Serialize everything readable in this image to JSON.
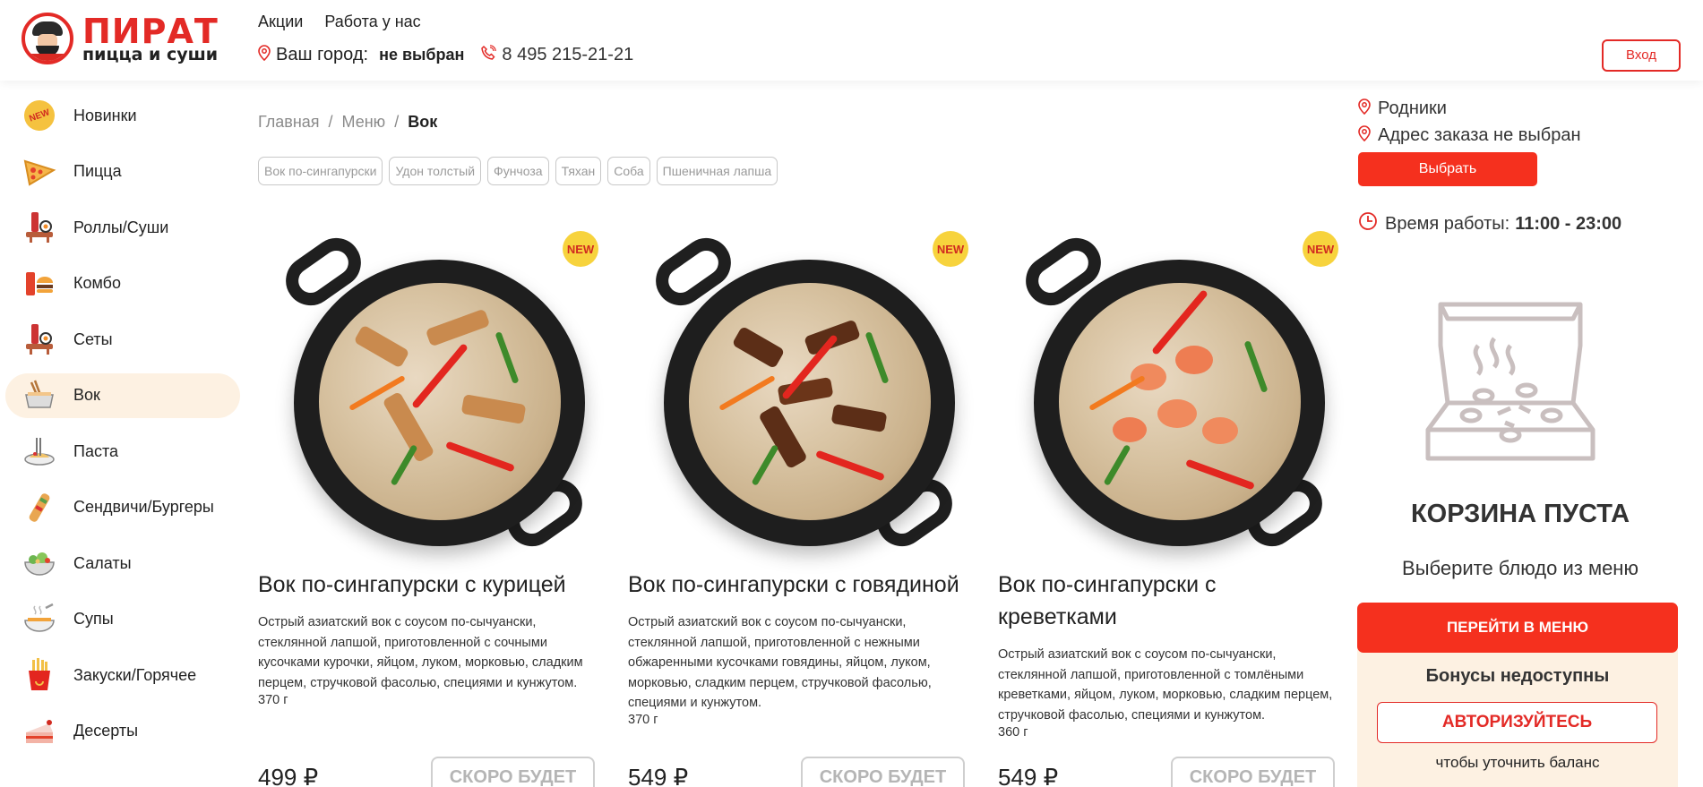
{
  "brand": {
    "name": "ПИРАТ",
    "tagline": "пицца и суши"
  },
  "header": {
    "nav": [
      "Акции",
      "Работа у нас"
    ],
    "city_label": "Ваш город:",
    "city_value": "не выбран",
    "phone": "8 495 215-21-21",
    "login_label": "Вход"
  },
  "sidebar": {
    "items": [
      {
        "label": "Новинки",
        "icon": "new-icon"
      },
      {
        "label": "Пицца",
        "icon": "pizza-icon"
      },
      {
        "label": "Роллы/Суши",
        "icon": "rolls-icon"
      },
      {
        "label": "Комбо",
        "icon": "combo-icon"
      },
      {
        "label": "Сеты",
        "icon": "sets-icon"
      },
      {
        "label": "Вок",
        "icon": "wok-icon",
        "active": true
      },
      {
        "label": "Паста",
        "icon": "pasta-icon"
      },
      {
        "label": "Сендвичи/Бургеры",
        "icon": "sandwich-icon"
      },
      {
        "label": "Салаты",
        "icon": "salad-icon"
      },
      {
        "label": "Супы",
        "icon": "soup-icon"
      },
      {
        "label": "Закуски/Горячее",
        "icon": "snacks-icon"
      },
      {
        "label": "Десерты",
        "icon": "dessert-icon"
      }
    ]
  },
  "breadcrumb": {
    "home": "Главная",
    "sep1": "/",
    "menu": "Меню",
    "sep2": "/",
    "current": "Вок"
  },
  "filters": [
    "Вок по-сингапурски",
    "Удон толстый",
    "Фунчоза",
    "Тяхан",
    "Соба",
    "Пшеничная лапша"
  ],
  "products": [
    {
      "badge": "NEW",
      "title": "Вок по-сингапурски с курицей",
      "desc": "Острый азиатский вок с соусом по-сычуански, стеклянной лапшой, приготовленной с сочными кусочками курочки, яйцом, луком, морковью, сладким перцем, стручковой фасолью, специями и кунжутом.",
      "weight": "370 г",
      "price": "499 ₽",
      "button": "СКОРО БУДЕТ"
    },
    {
      "badge": "NEW",
      "title": "Вок по-сингапурски с говядиной",
      "desc": "Острый азиатский вок с соусом по-сычуански, стеклянной лапшой, приготовленной с нежными обжаренными кусочками говядины, яйцом, луком, морковью, сладким перцем, стручковой фасолью, специями и кунжутом.",
      "weight": "370 г",
      "price": "549 ₽",
      "button": "СКОРО БУДЕТ"
    },
    {
      "badge": "NEW",
      "title": "Вок по-сингапурски с креветками",
      "desc": "Острый азиатский вок с соусом по-сычуански, стеклянной лапшой, приготовленной с томлёными креветками, яйцом, луком, морковью, сладким перцем, стручковой фасолью, специями и кунжутом.",
      "weight": "360 г",
      "price": "549 ₽",
      "button": "СКОРО БУДЕТ"
    }
  ],
  "right_panel": {
    "location": "Родники",
    "address": "Адрес заказа не выбран",
    "choose_label": "Выбрать",
    "hours_label": "Время работы:",
    "hours_value": "11:00 - 23:00",
    "cart_empty_title": "КОРЗИНА ПУСТА",
    "cart_empty_sub": "Выберите блюдо из меню",
    "go_menu_label": "ПЕРЕЙТИ В МЕНЮ",
    "bonus_title": "Бонусы недоступны",
    "auth_label": "АВТОРИЗУЙТЕСЬ",
    "bonus_note": "чтобы уточнить баланс"
  },
  "colors": {
    "accent": "#e32a26",
    "button_red": "#f5301e",
    "active_bg": "#fdf1e2",
    "badge_yellow": "#f7d33d"
  }
}
